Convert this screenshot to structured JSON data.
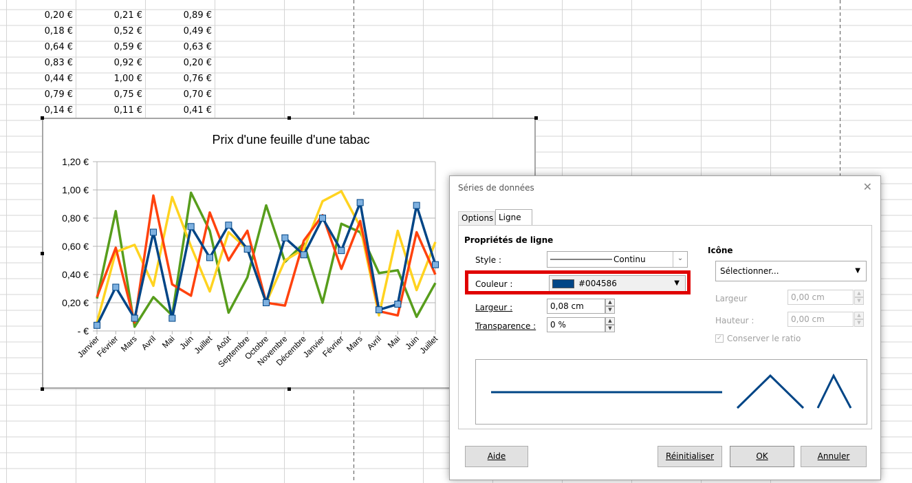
{
  "spreadsheet": {
    "rows": [
      [
        "0,20 €",
        "0,21 €",
        "0,89 €"
      ],
      [
        "0,18 €",
        "0,52 €",
        "0,49 €"
      ],
      [
        "0,64 €",
        "0,59 €",
        "0,63 €"
      ],
      [
        "0,83 €",
        "0,92 €",
        "0,20 €"
      ],
      [
        "0,44 €",
        "1,00 €",
        "0,76 €"
      ],
      [
        "0,79 €",
        "0,75 €",
        "0,70 €"
      ],
      [
        "0,14 €",
        "0,11 €",
        "0,41 €"
      ]
    ]
  },
  "chart_data": {
    "type": "line",
    "title": "Prix d'une feuille d'une tabac",
    "xlabel": "",
    "ylabel": "",
    "ylim": [
      0,
      1.2
    ],
    "y_ticks": [
      "1,20 €",
      "1,00 €",
      "0,80 €",
      "0,60 €",
      "0,40 €",
      "0,20 €",
      "- €"
    ],
    "grid": true,
    "legend": "none",
    "categories": [
      "Janvier",
      "Février",
      "Mars",
      "Avril",
      "Mai",
      "Juin",
      "Juillet",
      "Août",
      "Septembre",
      "Octobre",
      "Novembre",
      "Décembre",
      "Janvier",
      "Février",
      "Mars",
      "Avril",
      "Mai",
      "Juin",
      "Juillet"
    ],
    "series": [
      {
        "color": "#004586",
        "markers": true,
        "values": [
          0.04,
          0.31,
          0.09,
          0.7,
          0.09,
          0.74,
          0.52,
          0.75,
          0.58,
          0.2,
          0.66,
          0.54,
          0.8,
          0.57,
          0.91,
          0.15,
          0.19,
          0.89,
          0.47
        ]
      },
      {
        "color": "#ff420e",
        "markers": false,
        "values": [
          0.24,
          0.59,
          0.06,
          0.96,
          0.33,
          0.25,
          0.84,
          0.5,
          0.71,
          0.2,
          0.18,
          0.64,
          0.82,
          0.44,
          0.78,
          0.14,
          0.11,
          0.7,
          0.4
        ]
      },
      {
        "color": "#ffd320",
        "markers": false,
        "values": [
          0.06,
          0.56,
          0.61,
          0.32,
          0.95,
          0.6,
          0.28,
          0.7,
          0.58,
          0.2,
          0.5,
          0.58,
          0.92,
          0.99,
          0.74,
          0.11,
          0.71,
          0.29,
          0.63
        ]
      },
      {
        "color": "#579d1c",
        "markers": false,
        "values": [
          0.23,
          0.85,
          0.03,
          0.24,
          0.11,
          0.98,
          0.71,
          0.13,
          0.38,
          0.89,
          0.49,
          0.62,
          0.2,
          0.76,
          0.7,
          0.41,
          0.43,
          0.1,
          0.34
        ]
      }
    ]
  },
  "dialog": {
    "title": "Séries de données",
    "close_glyph": "✕",
    "tabs": [
      "Options",
      "Ligne"
    ],
    "line_props": {
      "section": "Propriétés de ligne",
      "style_label": "Style :",
      "style_value": "Continu",
      "color_label": "Couleur :",
      "color_value": "#004586",
      "color_swatch": "#004586",
      "width_label": "Largeur :",
      "width_value": "0,08 cm",
      "transparency_label": "Transparence :",
      "transparency_value": "0 %"
    },
    "icon_props": {
      "section": "Icône",
      "select_label": "Sélectionner...",
      "width_label": "Largeur",
      "width_value": "0,00 cm",
      "height_label": "Hauteur :",
      "height_value": "0,00 cm",
      "keep_ratio_label": "Conserver le ratio"
    },
    "preview_color": "#004586",
    "buttons": {
      "help": "Aide",
      "reset": "Réinitialiser",
      "ok": "OK",
      "cancel": "Annuler"
    }
  }
}
